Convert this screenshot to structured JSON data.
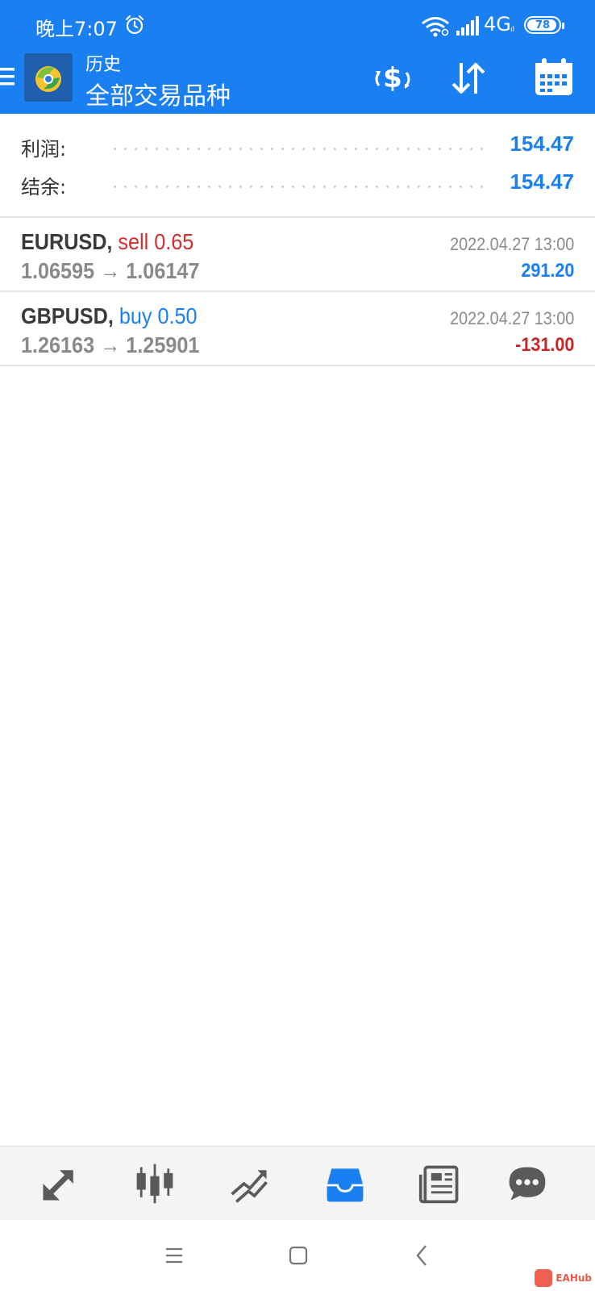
{
  "status_bar": {
    "time": "晚上7:07",
    "network": "4G",
    "network_sub": "ıl",
    "battery": "78"
  },
  "header": {
    "subtitle": "历史",
    "title": "全部交易品种"
  },
  "summary": {
    "profit_label": "利润:",
    "profit_value": "154.47",
    "balance_label": "结余:",
    "balance_value": "154.47"
  },
  "trades": [
    {
      "symbol": "EURUSD,",
      "side": "sell 0.65",
      "prices": "1.06595 → 1.06147",
      "time": "2022.04.27 13:00",
      "profit": "291.20"
    },
    {
      "symbol": "GBPUSD,",
      "side": "buy 0.50",
      "prices": "1.26163 → 1.25901",
      "time": "2022.04.27 13:00",
      "profit": "-131.00"
    }
  ],
  "colors": {
    "accent": "#1a7ff0",
    "sell": "#d32f2f",
    "buy": "#1a7ff0",
    "loss": "#c62828",
    "profit": "#1a7ff0"
  },
  "nav": [
    "quotes-icon",
    "chart-icon",
    "trade-icon",
    "history-icon",
    "news-icon",
    "chat-icon"
  ],
  "watermark": "EAHub"
}
